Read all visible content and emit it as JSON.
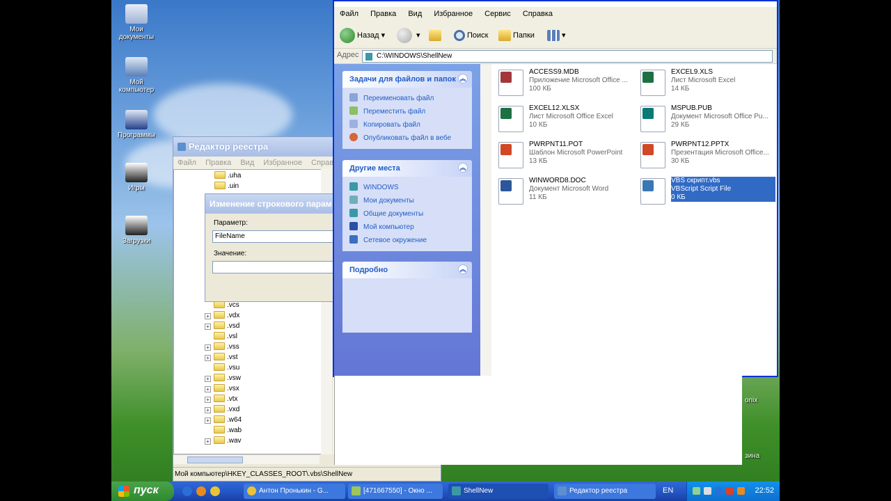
{
  "desktop": {
    "icons": [
      {
        "label": "Мои документы"
      },
      {
        "label": "Мой компьютер"
      },
      {
        "label": "Программы"
      },
      {
        "label": "Игры"
      },
      {
        "label": "Загрузки"
      }
    ],
    "right_labels": [
      "onix",
      "зина"
    ]
  },
  "regedit": {
    "title": "Редактор реестра",
    "menu": [
      "Файл",
      "Правка",
      "Вид",
      "Избранное",
      "Справка"
    ],
    "tree_top": [
      {
        "label": ".uha",
        "expand": false
      },
      {
        "label": ".uin",
        "expand": false
      }
    ],
    "tree": [
      {
        "label": ".vcs",
        "expand": false
      },
      {
        "label": ".vdx",
        "expand": true
      },
      {
        "label": ".vsd",
        "expand": true
      },
      {
        "label": ".vsl",
        "expand": false
      },
      {
        "label": ".vss",
        "expand": true
      },
      {
        "label": ".vst",
        "expand": true
      },
      {
        "label": ".vsu",
        "expand": false
      },
      {
        "label": ".vsw",
        "expand": true
      },
      {
        "label": ".vsx",
        "expand": true
      },
      {
        "label": ".vtx",
        "expand": true
      },
      {
        "label": ".vxd",
        "expand": true
      },
      {
        "label": ".w64",
        "expand": true
      },
      {
        "label": ".wab",
        "expand": false
      },
      {
        "label": ".wav",
        "expand": true
      }
    ],
    "status": "Мой компьютер\\HKEY_CLASSES_ROOT\\.vbs\\ShellNew"
  },
  "dialog": {
    "title": "Изменение строкового парам",
    "param_label": "Параметр:",
    "param_value": "FileName",
    "value_label": "Значение:",
    "value_value": ""
  },
  "explorer": {
    "menu": [
      "Файл",
      "Правка",
      "Вид",
      "Избранное",
      "Сервис",
      "Справка"
    ],
    "back_label": "Назад",
    "search_label": "Поиск",
    "folders_label": "Папки",
    "address_label": "Адрес",
    "address": "C:\\WINDOWS\\ShellNew",
    "tasks_title": "Задачи для файлов и папок",
    "tasks": [
      "Переименовать файл",
      "Переместить файл",
      "Копировать файл",
      "Опубликовать файл в вебе"
    ],
    "places_title": "Другие места",
    "places": [
      "WINDOWS",
      "Мои документы",
      "Общие документы",
      "Мой компьютер",
      "Сетевое окружение"
    ],
    "details_title": "Подробно",
    "files": [
      {
        "name": "ACCESS9.MDB",
        "type": "Приложение Microsoft Office ...",
        "size": "100 КБ",
        "color": "#a4373a"
      },
      {
        "name": "EXCEL9.XLS",
        "type": "Лист Microsoft Excel",
        "size": "14 КБ",
        "color": "#1d7044"
      },
      {
        "name": "EXCEL12.XLSX",
        "type": "Лист Microsoft Office Excel",
        "size": "10 КБ",
        "color": "#1d7044"
      },
      {
        "name": "MSPUB.PUB",
        "type": "Документ Microsoft Office Pu...",
        "size": "29 КБ",
        "color": "#0b7a74"
      },
      {
        "name": "PWRPNT11.POT",
        "type": "Шаблон Microsoft PowerPoint",
        "size": "13 КБ",
        "color": "#d24726"
      },
      {
        "name": "PWRPNT12.PPTX",
        "type": "Презентация Microsoft Office...",
        "size": "30 КБ",
        "color": "#d24726"
      },
      {
        "name": "WINWORD8.DOC",
        "type": "Документ Microsoft Word",
        "size": "11 КБ",
        "color": "#2b579a"
      },
      {
        "name": "VBS скрипт.vbs",
        "type": "VBScript Script File",
        "size": "0 КБ",
        "color": "#3a78b5",
        "selected": true
      }
    ]
  },
  "taskbar": {
    "start": "пуск",
    "tasks": [
      {
        "label": "Антон Пронькин - G..."
      },
      {
        "label": "[471667550] - Окно ..."
      },
      {
        "label": "ShellNew"
      },
      {
        "label": "Редактор реестра"
      }
    ],
    "lang": "EN",
    "clock": "22:52"
  }
}
